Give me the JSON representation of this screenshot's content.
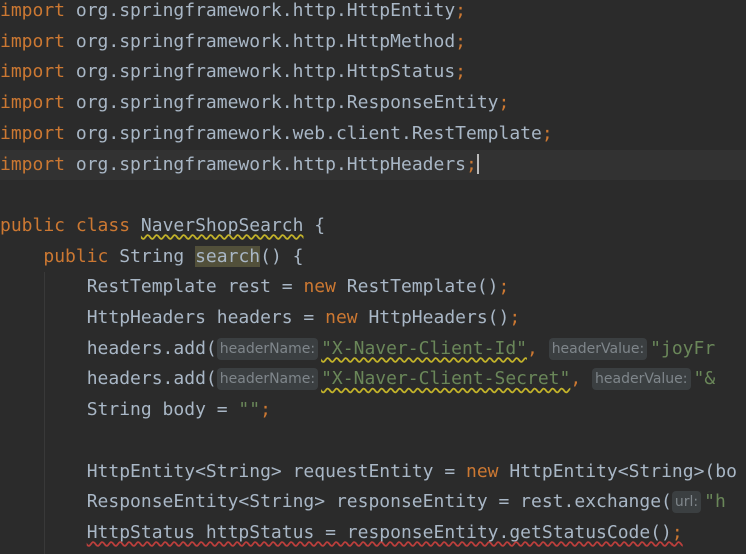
{
  "colors": {
    "background": "#2b2b2b",
    "current_line": "#323232",
    "keyword": "#cc7832",
    "string": "#6a8759",
    "text": "#a9b7c6",
    "hint_bg": "#3b3f41",
    "hint_text": "#7f868b",
    "identifier_highlight": "#52503a"
  },
  "lines": [
    {
      "tokens": [
        {
          "t": "import",
          "c": "kw"
        },
        {
          "t": " org.springframework.http.HttpEntity",
          "c": "pln"
        },
        {
          "t": ";",
          "c": "kw"
        }
      ]
    },
    {
      "tokens": [
        {
          "t": "import",
          "c": "kw"
        },
        {
          "t": " org.springframework.http.HttpMethod",
          "c": "pln"
        },
        {
          "t": ";",
          "c": "kw"
        }
      ]
    },
    {
      "tokens": [
        {
          "t": "import",
          "c": "kw"
        },
        {
          "t": " org.springframework.http.HttpStatus",
          "c": "pln"
        },
        {
          "t": ";",
          "c": "kw"
        }
      ]
    },
    {
      "tokens": [
        {
          "t": "import",
          "c": "kw"
        },
        {
          "t": " org.springframework.http.ResponseEntity",
          "c": "pln"
        },
        {
          "t": ";",
          "c": "kw"
        }
      ]
    },
    {
      "tokens": [
        {
          "t": "import",
          "c": "kw"
        },
        {
          "t": " org.springframework.web.client.RestTemplate",
          "c": "pln"
        },
        {
          "t": ";",
          "c": "kw"
        }
      ]
    },
    {
      "current": true,
      "tokens": [
        {
          "t": "import",
          "c": "kw"
        },
        {
          "t": " org.springframework.http.HttpHeaders",
          "c": "pln"
        },
        {
          "t": ";",
          "c": "kw"
        },
        {
          "t": "",
          "c": "caret"
        }
      ]
    },
    {
      "tokens": []
    },
    {
      "tokens": [
        {
          "t": "public",
          "c": "kw"
        },
        {
          "t": " ",
          "c": "pln"
        },
        {
          "t": "class",
          "c": "kw"
        },
        {
          "t": " ",
          "c": "pln"
        },
        {
          "t": "NaverShopSearch",
          "c": "pln sq"
        },
        {
          "t": " {",
          "c": "pln"
        }
      ]
    },
    {
      "tokens": [
        {
          "t": "    ",
          "c": "pln"
        },
        {
          "t": "public",
          "c": "kw"
        },
        {
          "t": " String ",
          "c": "pln"
        },
        {
          "t": "search",
          "c": "pln hl"
        },
        {
          "t": "() {",
          "c": "pln"
        }
      ]
    },
    {
      "tokens": [
        {
          "t": "        RestTemplate rest = ",
          "c": "pln"
        },
        {
          "t": "new",
          "c": "kw"
        },
        {
          "t": " RestTemplate()",
          "c": "pln"
        },
        {
          "t": ";",
          "c": "kw"
        }
      ]
    },
    {
      "tokens": [
        {
          "t": "        HttpHeaders headers = ",
          "c": "pln"
        },
        {
          "t": "new",
          "c": "kw"
        },
        {
          "t": " HttpHeaders()",
          "c": "pln"
        },
        {
          "t": ";",
          "c": "kw"
        }
      ]
    },
    {
      "tokens": [
        {
          "t": "        headers.add(",
          "c": "pln"
        },
        {
          "t": "headerName:",
          "c": "hint"
        },
        {
          "t": "\"X-Naver-Client-Id\"",
          "c": "str sq"
        },
        {
          "t": ",",
          "c": "kw"
        },
        {
          "t": " ",
          "c": "pln"
        },
        {
          "t": "headerValue:",
          "c": "hint"
        },
        {
          "t": "\"joyFr",
          "c": "str"
        }
      ]
    },
    {
      "tokens": [
        {
          "t": "        headers.add(",
          "c": "pln"
        },
        {
          "t": "headerName:",
          "c": "hint"
        },
        {
          "t": "\"X-Naver-Client-Secret\"",
          "c": "str sq"
        },
        {
          "t": ",",
          "c": "kw"
        },
        {
          "t": " ",
          "c": "pln"
        },
        {
          "t": "headerValue:",
          "c": "hint"
        },
        {
          "t": "\"&",
          "c": "str"
        }
      ]
    },
    {
      "tokens": [
        {
          "t": "        String body = ",
          "c": "pln"
        },
        {
          "t": "\"\"",
          "c": "str"
        },
        {
          "t": ";",
          "c": "kw"
        }
      ]
    },
    {
      "tokens": []
    },
    {
      "tokens": [
        {
          "t": "        HttpEntity<String> requestEntity = ",
          "c": "pln"
        },
        {
          "t": "new",
          "c": "kw"
        },
        {
          "t": " HttpEntity<",
          "c": "pln"
        },
        {
          "t": "String",
          "c": "gen"
        },
        {
          "t": ">(bo",
          "c": "pln"
        }
      ]
    },
    {
      "tokens": [
        {
          "t": "        ResponseEntity<String> responseEntity = rest.exchange(",
          "c": "pln"
        },
        {
          "t": "url:",
          "c": "hint"
        },
        {
          "t": "\"h",
          "c": "str"
        }
      ]
    },
    {
      "tokens": [
        {
          "t": "        ",
          "c": "pln"
        },
        {
          "t": "HttpStatus httpStatus = responseEntity.getStatusCode()",
          "c": "pln err"
        },
        {
          "t": ";",
          "c": "kw err"
        }
      ]
    }
  ]
}
